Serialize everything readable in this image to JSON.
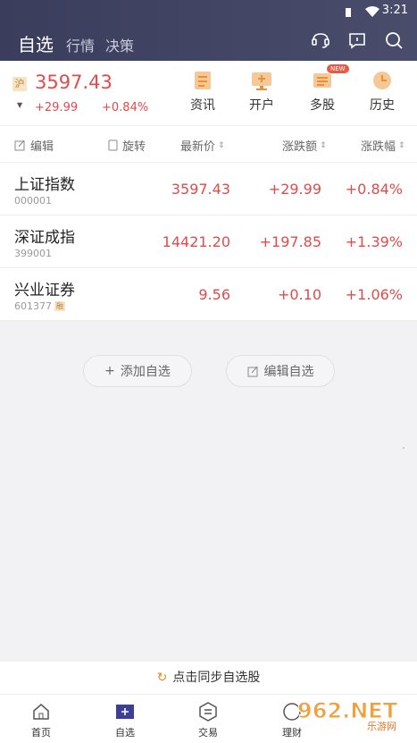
{
  "status_bar": {
    "time": "3:21"
  },
  "header": {
    "tabs": [
      {
        "label": "自选",
        "active": true
      },
      {
        "label": "行情",
        "active": false
      },
      {
        "label": "决策",
        "active": false
      }
    ],
    "icons": [
      "service-icon",
      "message-icon",
      "search-icon"
    ]
  },
  "index": {
    "market_tag": "沪",
    "price": "3597.43",
    "change": "+29.99",
    "change_pct": "+0.84%",
    "arrow": "▼"
  },
  "quick_actions": [
    {
      "label": "资讯",
      "icon": "news-icon"
    },
    {
      "label": "开户",
      "icon": "open-account-icon"
    },
    {
      "label": "多股",
      "icon": "multi-stock-icon",
      "badge": "NEW"
    },
    {
      "label": "历史",
      "icon": "history-icon"
    }
  ],
  "columns": {
    "edit": "编辑",
    "rotate": "旋转",
    "latest": "最新价",
    "change": "涨跌额",
    "change_pct": "涨跌幅"
  },
  "stocks": [
    {
      "name": "上证指数",
      "code": "000001",
      "price": "3597.43",
      "change": "+29.99",
      "change_pct": "+0.84%"
    },
    {
      "name": "深证成指",
      "code": "399001",
      "price": "14421.20",
      "change": "+197.85",
      "change_pct": "+1.39%"
    },
    {
      "name": "兴业证券",
      "code": "601377",
      "tag": "融",
      "price": "9.56",
      "change": "+0.10",
      "change_pct": "+1.06%"
    }
  ],
  "actions": {
    "add": "添加自选",
    "edit": "编辑自选"
  },
  "sync": {
    "label": "点击同步自选股"
  },
  "bottom_nav": [
    {
      "label": "首页",
      "icon": "home-icon"
    },
    {
      "label": "自选",
      "icon": "watchlist-icon",
      "active": true
    },
    {
      "label": "交易",
      "icon": "trade-icon"
    },
    {
      "label": "理财",
      "icon": "finance-icon"
    }
  ],
  "watermark": {
    "text": "962.NET",
    "sub": "乐游网"
  },
  "colors": {
    "up": "#e04b4b",
    "header_bg": "#3b3d5c",
    "accent": "#e08a2e"
  }
}
